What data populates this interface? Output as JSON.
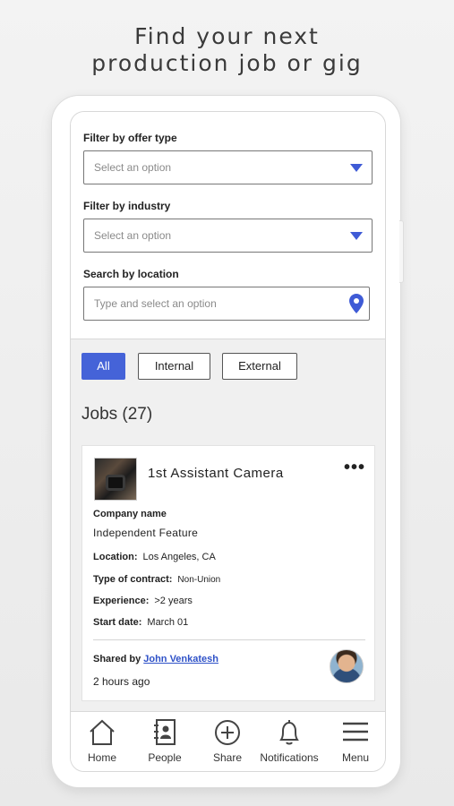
{
  "headline": {
    "line1": "Find your next",
    "line2": "production job or gig"
  },
  "filters": {
    "offer_type": {
      "label": "Filter by offer type",
      "placeholder": "Select an option"
    },
    "industry": {
      "label": "Filter by industry",
      "placeholder": "Select an option"
    },
    "location": {
      "label": "Search by location",
      "placeholder": "Type and select an option"
    }
  },
  "chips": {
    "all": "All",
    "internal": "Internal",
    "external": "External"
  },
  "jobs": {
    "heading": "Jobs (27)"
  },
  "job_card": {
    "title": "1st Assistant Camera",
    "more_icon": "•••",
    "company_label": "Company name",
    "company_value": "Independent Feature",
    "location_label": "Location:",
    "location_value": "Los Angeles, CA",
    "contract_label": "Type of contract:",
    "contract_value": "Non-Union",
    "experience_label": "Experience:",
    "experience_value": ">2 years",
    "start_label": "Start date:",
    "start_value": "March 01",
    "shared_label": "Shared by",
    "shared_name": "John Venkatesh",
    "time_ago": "2 hours ago"
  },
  "nav": {
    "home": "Home",
    "people": "People",
    "share": "Share",
    "notifications": "Notifications",
    "menu": "Menu"
  },
  "colors": {
    "accent": "#4563d8",
    "link": "#2f52c8"
  }
}
